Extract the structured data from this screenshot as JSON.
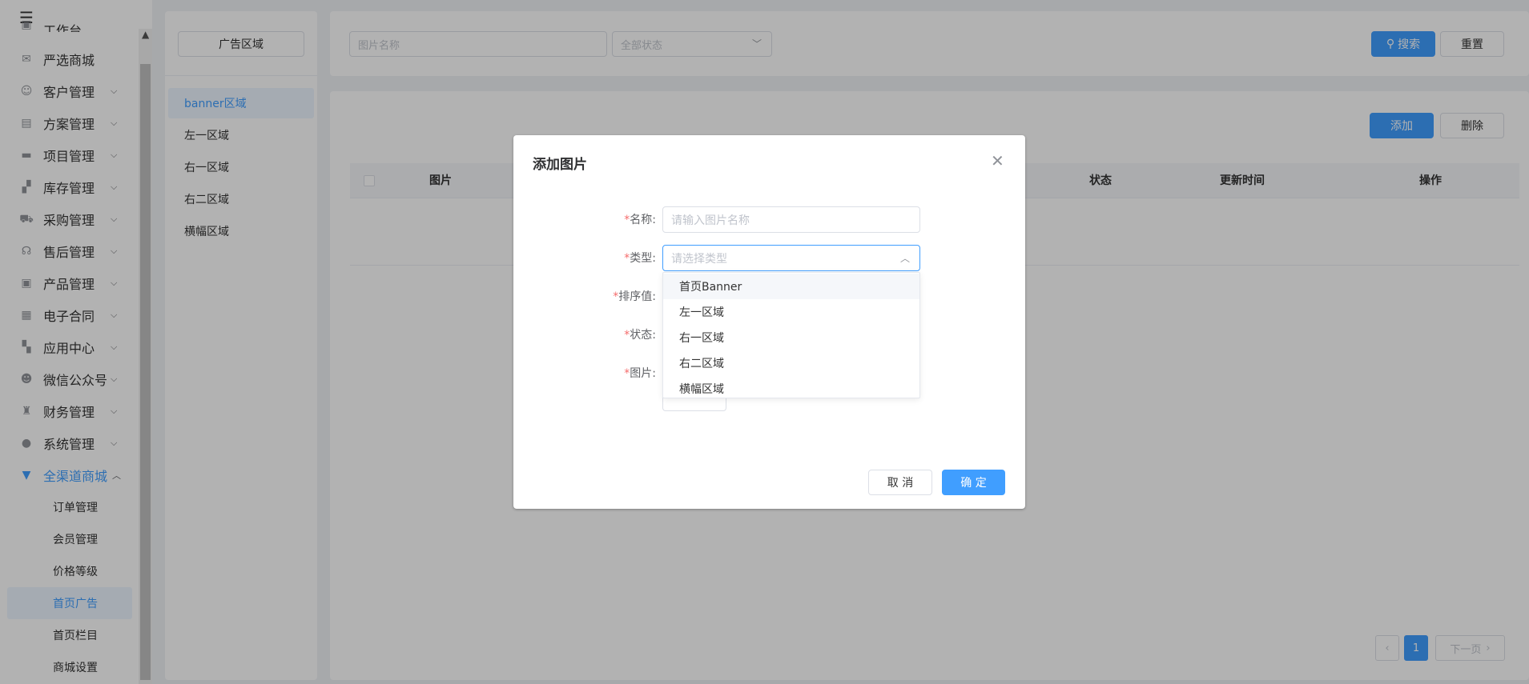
{
  "sidebar": {
    "collapse_icon": "menu-fold-icon",
    "partial_top_label": "工作台",
    "items": [
      {
        "label": "严选商城",
        "icon": "mail-icon",
        "has_arrow": false
      },
      {
        "label": "客户管理",
        "icon": "user-card-icon",
        "has_arrow": true
      },
      {
        "label": "方案管理",
        "icon": "document-icon",
        "has_arrow": true
      },
      {
        "label": "项目管理",
        "icon": "folder-icon",
        "has_arrow": true
      },
      {
        "label": "库存管理",
        "icon": "boxes-icon",
        "has_arrow": true
      },
      {
        "label": "采购管理",
        "icon": "cart-icon",
        "has_arrow": true
      },
      {
        "label": "售后管理",
        "icon": "headset-icon",
        "has_arrow": true
      },
      {
        "label": "产品管理",
        "icon": "box-icon",
        "has_arrow": true
      },
      {
        "label": "电子合同",
        "icon": "contract-icon",
        "has_arrow": true
      },
      {
        "label": "应用中心",
        "icon": "apps-icon",
        "has_arrow": true
      },
      {
        "label": "微信公众号",
        "icon": "wechat-user-icon",
        "has_arrow": true
      },
      {
        "label": "财务管理",
        "icon": "money-bag-icon",
        "has_arrow": true
      },
      {
        "label": "系统管理",
        "icon": "settings-icon",
        "has_arrow": true
      },
      {
        "label": "全渠道商城",
        "icon": "store-icon",
        "has_arrow": true
      }
    ],
    "sub_items": [
      {
        "label": "订单管理"
      },
      {
        "label": "会员管理"
      },
      {
        "label": "价格等级"
      },
      {
        "label": "首页广告"
      },
      {
        "label": "首页栏目"
      },
      {
        "label": "商城设置"
      }
    ],
    "active_sub": "首页广告"
  },
  "area_panel": {
    "button_label": "广告区域",
    "items": [
      "banner区域",
      "左一区域",
      "右一区域",
      "右二区域",
      "横幅区域"
    ],
    "active": "banner区域"
  },
  "search": {
    "name_placeholder": "图片名称",
    "status_placeholder": "全部状态",
    "search_label": "搜索",
    "reset_label": "重置"
  },
  "table": {
    "add_label": "添加",
    "delete_label": "删除",
    "columns": {
      "image": "图片",
      "status": "状态",
      "updated": "更新时间",
      "actions": "操作"
    }
  },
  "pagination": {
    "current_page": "1",
    "next_label": "下一页"
  },
  "dialog": {
    "title": "添加图片",
    "fields": {
      "name_label": "名称:",
      "name_placeholder": "请输入图片名称",
      "type_label": "类型:",
      "type_placeholder": "请选择类型",
      "sort_label": "排序值:",
      "status_label": "状态:",
      "image_label": "图片:"
    },
    "type_options": [
      "首页Banner",
      "左一区域",
      "右一区域",
      "右二区域",
      "横幅区域"
    ],
    "cancel_label": "取 消",
    "confirm_label": "确 定"
  },
  "colors": {
    "accent": "#409eff",
    "required": "#f56c6c"
  }
}
